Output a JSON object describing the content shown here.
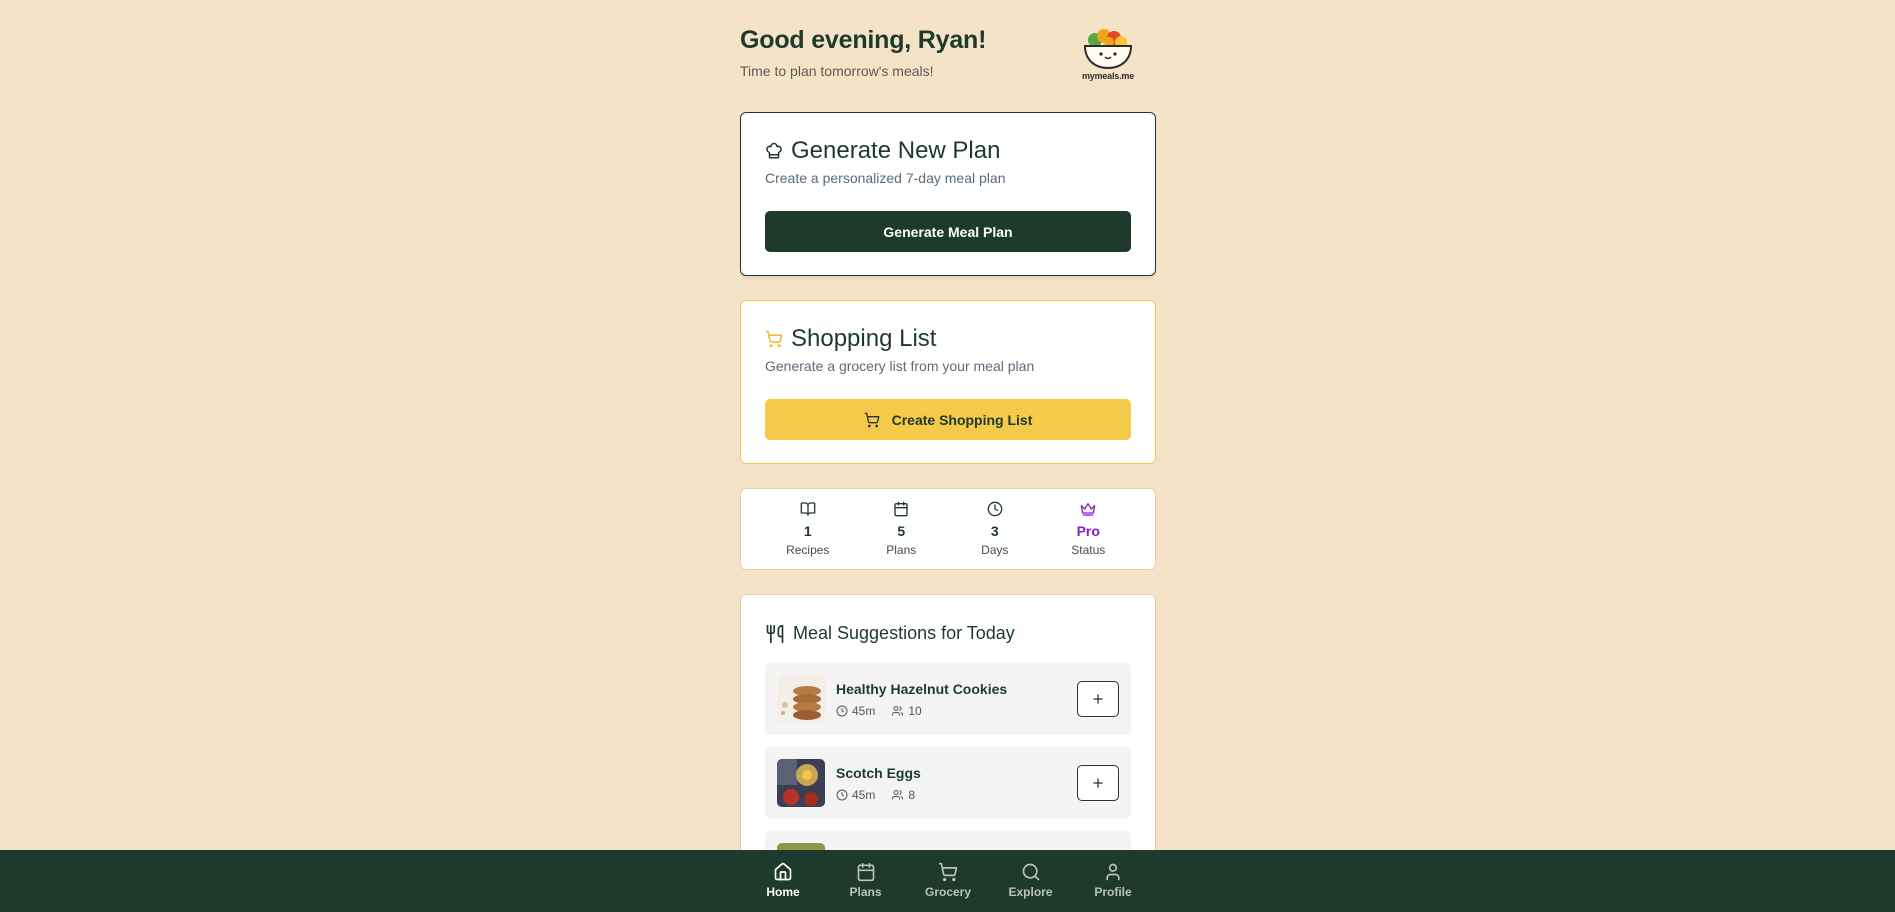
{
  "header": {
    "greeting": "Good evening, Ryan!",
    "subtitle": "Time to plan tomorrow's meals!",
    "logo_text": "mymeals.me"
  },
  "generate_card": {
    "title": "Generate New Plan",
    "subtitle": "Create a personalized 7-day meal plan",
    "button_label": "Generate Meal Plan",
    "icon": "chef-hat-icon"
  },
  "shopping_card": {
    "title": "Shopping List",
    "subtitle": "Generate a grocery list from your meal plan",
    "button_label": "Create Shopping List",
    "icon": "cart-icon"
  },
  "stats": [
    {
      "value": "1",
      "label": "Recipes",
      "icon": "book-icon"
    },
    {
      "value": "5",
      "label": "Plans",
      "icon": "calendar-icon"
    },
    {
      "value": "3",
      "label": "Days",
      "icon": "clock-icon"
    },
    {
      "value": "Pro",
      "label": "Status",
      "icon": "crown-icon"
    }
  ],
  "suggestions": {
    "title": "Meal Suggestions for Today",
    "meals": [
      {
        "name": "Healthy Hazelnut Cookies",
        "time": "45m",
        "servings": "10"
      },
      {
        "name": "Scotch Eggs",
        "time": "45m",
        "servings": "8"
      }
    ]
  },
  "nav": [
    {
      "label": "Home",
      "icon": "home-icon",
      "active": true
    },
    {
      "label": "Plans",
      "icon": "calendar-icon"
    },
    {
      "label": "Grocery",
      "icon": "cart-icon"
    },
    {
      "label": "Explore",
      "icon": "search-icon"
    },
    {
      "label": "Profile",
      "icon": "user-icon"
    }
  ],
  "colors": {
    "background": "#f5e3c8",
    "primary": "#1d3a2c",
    "accent_yellow": "#f5c94a",
    "pro_purple": "#7e22ce"
  }
}
